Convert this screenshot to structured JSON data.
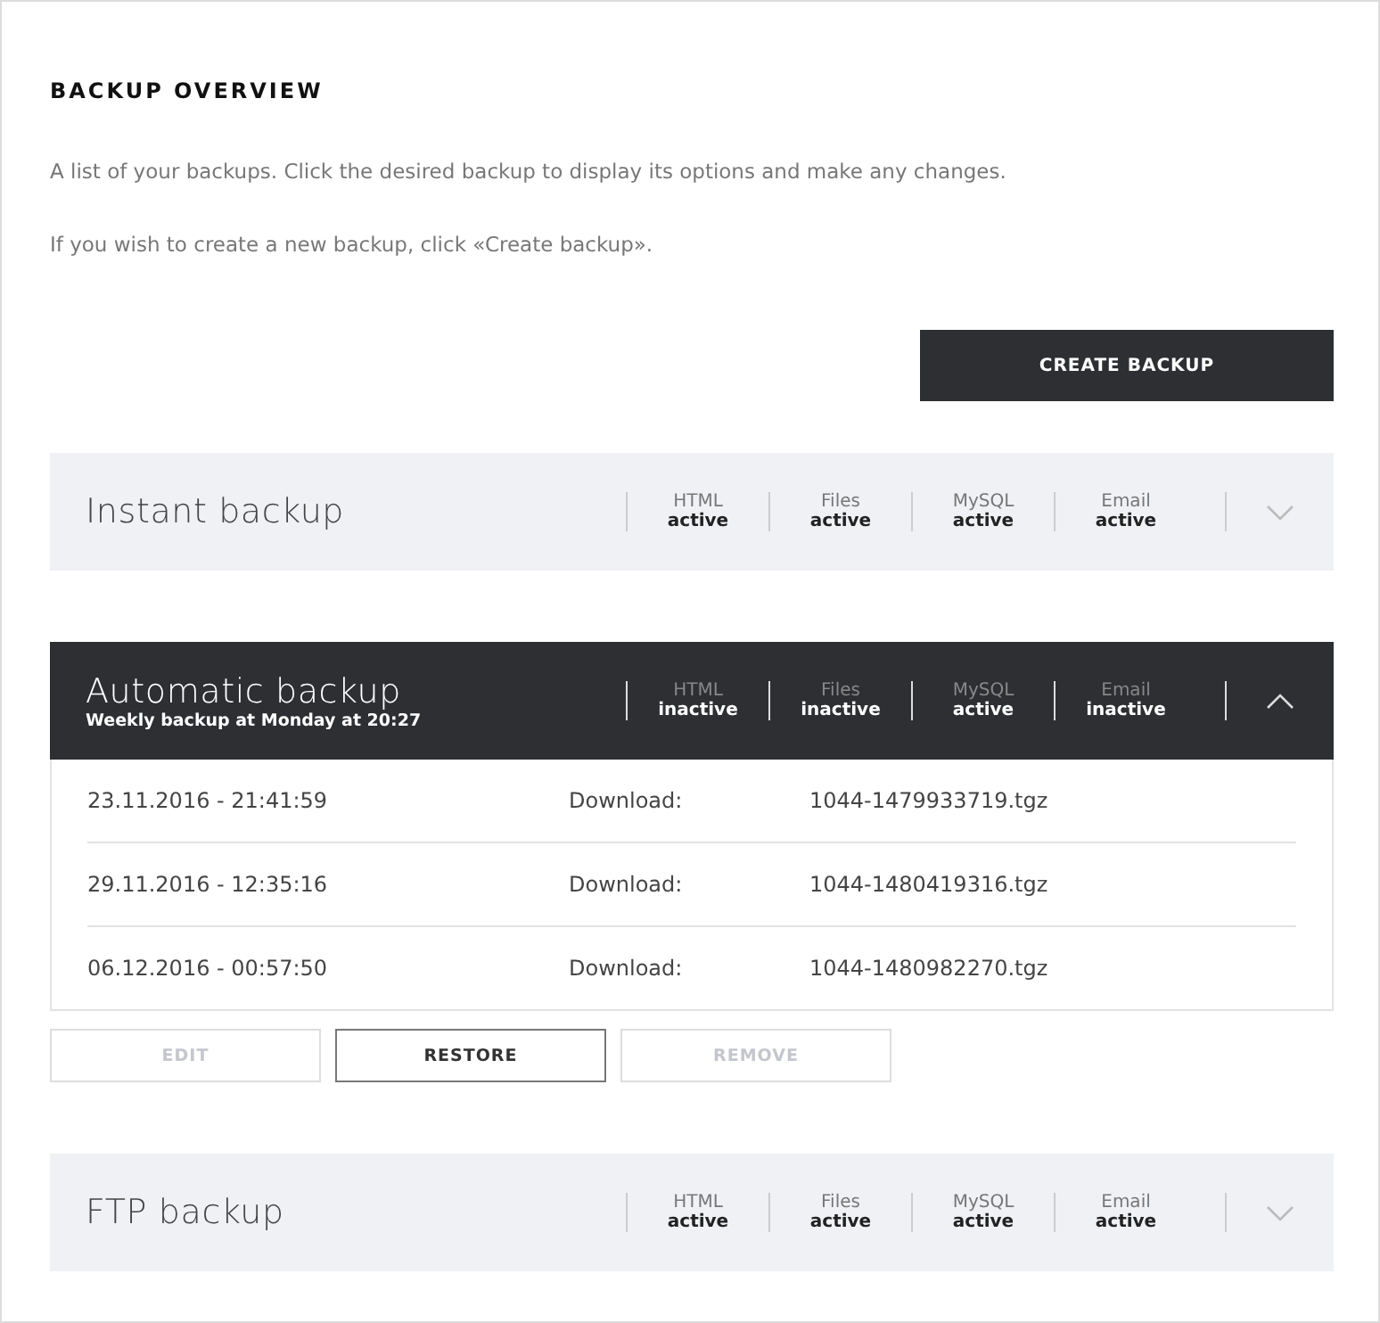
{
  "heading": "BACKUP OVERVIEW",
  "intro": [
    "A list of your backups. Click the desired backup to display its options and make any changes.",
    "If you wish to create a new backup, click «Create backup»."
  ],
  "create_button": "CREATE BACKUP",
  "backups": [
    {
      "title": "Instant backup",
      "expanded": false,
      "statuses": [
        {
          "label": "HTML",
          "value": "active"
        },
        {
          "label": "Files",
          "value": "active"
        },
        {
          "label": "MySQL",
          "value": "active"
        },
        {
          "label": "Email",
          "value": "active"
        }
      ]
    },
    {
      "title": "Automatic backup",
      "subtitle": "Weekly backup at Monday at 20:27",
      "expanded": true,
      "statuses": [
        {
          "label": "HTML",
          "value": "inactive"
        },
        {
          "label": "Files",
          "value": "inactive"
        },
        {
          "label": "MySQL",
          "value": "active"
        },
        {
          "label": "Email",
          "value": "inactive"
        }
      ],
      "files": [
        {
          "date": "23.11.2016 - 21:41:59",
          "label": "Download:",
          "file": "1044-1479933719.tgz"
        },
        {
          "date": "29.11.2016 - 12:35:16",
          "label": "Download:",
          "file": "1044-1480419316.tgz"
        },
        {
          "date": "06.12.2016 - 00:57:50",
          "label": "Download:",
          "file": "1044-1480982270.tgz"
        }
      ],
      "actions": [
        {
          "label": "EDIT",
          "disabled": true
        },
        {
          "label": "RESTORE",
          "disabled": false
        },
        {
          "label": "REMOVE",
          "disabled": true
        }
      ]
    },
    {
      "title": "FTP backup",
      "expanded": false,
      "statuses": [
        {
          "label": "HTML",
          "value": "active"
        },
        {
          "label": "Files",
          "value": "active"
        },
        {
          "label": "MySQL",
          "value": "active"
        },
        {
          "label": "Email",
          "value": "active"
        }
      ]
    }
  ]
}
